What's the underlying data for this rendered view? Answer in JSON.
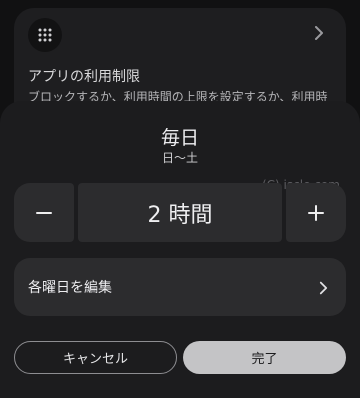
{
  "background_card": {
    "title": "アプリの利用制限",
    "description": "ブロックするか、利用時間の上限を設定するか、利用時",
    "icon": "apps-grid-icon",
    "chevron_icon": "chevron-right-icon"
  },
  "sheet": {
    "title": "毎日",
    "subtitle": "日〜土",
    "watermark": "(C) iscle.com",
    "stepper": {
      "value_label": "2 時間",
      "minus_icon": "minus-icon",
      "plus_icon": "plus-icon"
    },
    "edit_row": {
      "label": "各曜日を編集",
      "chevron_icon": "chevron-right-icon"
    },
    "buttons": {
      "cancel_label": "キャンセル",
      "done_label": "完了"
    }
  },
  "colors": {
    "sheet_bg": "#1c1c1e",
    "control_bg": "#2c2c2e",
    "done_bg": "#c4c4c6"
  }
}
